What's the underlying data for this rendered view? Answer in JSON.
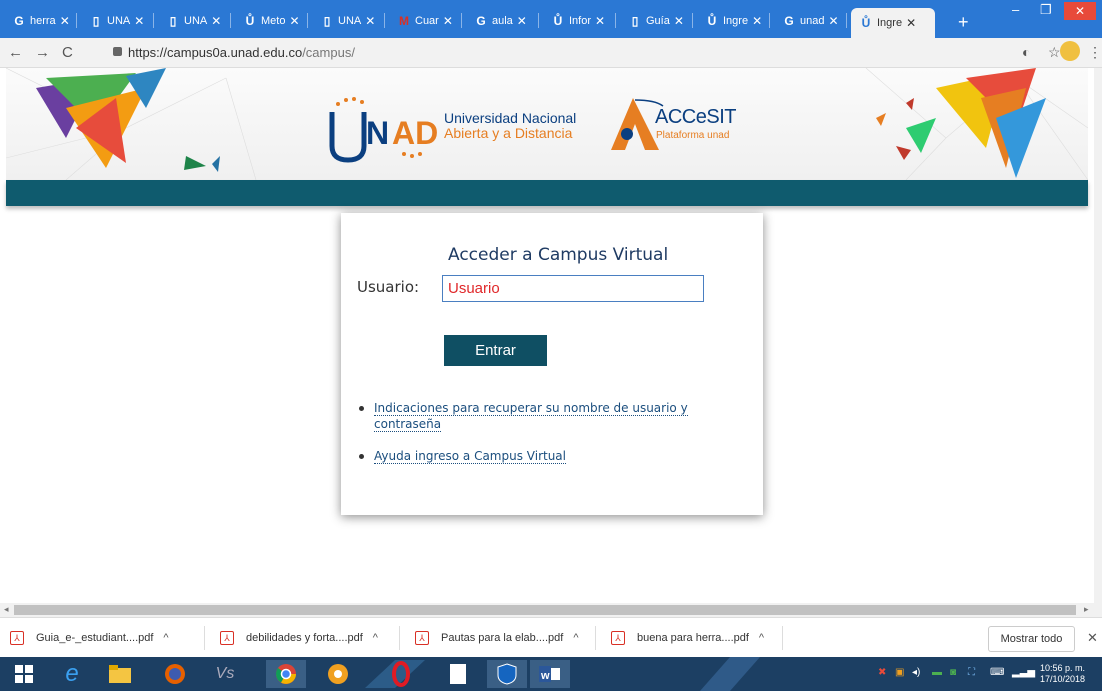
{
  "browser": {
    "tabs": [
      {
        "icon": "G",
        "label": "herra",
        "icon_name": "google-icon"
      },
      {
        "icon": "▯",
        "label": "UNA",
        "icon_name": "page-icon"
      },
      {
        "icon": "▯",
        "label": "UNA",
        "icon_name": "page-icon"
      },
      {
        "icon": "Ů",
        "label": "Meto",
        "icon_name": "unad-icon"
      },
      {
        "icon": "▯",
        "label": "UNA",
        "icon_name": "page-icon"
      },
      {
        "icon": "M",
        "label": "Cuar",
        "icon_name": "gmail-icon"
      },
      {
        "icon": "G",
        "label": "aula",
        "icon_name": "google-icon"
      },
      {
        "icon": "Ů",
        "label": "Infor",
        "icon_name": "unad-icon"
      },
      {
        "icon": "▯",
        "label": "Guía",
        "icon_name": "page-icon"
      },
      {
        "icon": "Ů",
        "label": "Ingre",
        "icon_name": "unad-icon"
      },
      {
        "icon": "G",
        "label": "unad",
        "icon_name": "google-icon"
      },
      {
        "icon": "Ů",
        "label": "Ingre",
        "icon_name": "unad-icon",
        "active": true
      }
    ],
    "url_host": "https://campus0a.unad.edu.co",
    "url_path": "/campus/"
  },
  "header": {
    "unad_line1": "Universidad Nacional",
    "unad_line2": "Abierta y a Distancia",
    "accesit_title": "ACCeSIT",
    "accesit_sub": "Plataforma unad"
  },
  "login": {
    "title": "Acceder a Campus Virtual",
    "user_label": "Usuario:",
    "user_value": "Usuario",
    "submit_label": "Entrar",
    "link_recover": "Indicaciones para recuperar su nombre de usuario y contraseña",
    "link_help": "Ayuda ingreso a Campus Virtual"
  },
  "downloads": {
    "items": [
      "Guia_e-_estudiant....pdf",
      "debilidades y forta....pdf",
      "Pautas para la elab....pdf",
      "buena para herra....pdf"
    ],
    "show_all": "Mostrar todo"
  },
  "taskbar": {
    "time": "10:56 p. m.",
    "date": "17/10/2018"
  },
  "colors": {
    "tabbar": "#2b78d4",
    "teal_band": "#0f5b6e",
    "button": "#0f4f63",
    "input_text": "#e0282a"
  }
}
